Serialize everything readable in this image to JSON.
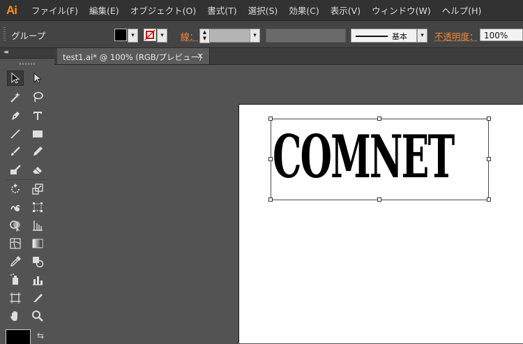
{
  "app": {
    "logo": "Ai"
  },
  "menu": [
    "ファイル(F)",
    "編集(E)",
    "オブジェクト(O)",
    "書式(T)",
    "選択(S)",
    "効果(C)",
    "表示(V)",
    "ウィンドウ(W)",
    "ヘルプ(H)"
  ],
  "control": {
    "selection_label": "グループ",
    "stroke_label": "線：",
    "stroke_profile": "基本",
    "opacity_label": "不透明度：",
    "opacity_value": "100%"
  },
  "document": {
    "tab_title": "test1.ai* @ 100% (RGB/プレビュー)",
    "close_symbol": "×"
  },
  "artwork": {
    "text": "COMNET"
  },
  "toolbar": {
    "collapse_symbol": "◂◂",
    "swap_symbol": "⇆",
    "tools": [
      "selection-tool",
      "direct-selection-tool",
      "magic-wand-tool",
      "lasso-tool",
      "pen-tool",
      "type-tool",
      "line-tool",
      "rectangle-tool",
      "paintbrush-tool",
      "pencil-tool",
      "blob-brush-tool",
      "eraser-tool",
      "rotate-tool",
      "scale-tool",
      "warp-tool",
      "free-transform-tool",
      "shape-builder-tool",
      "perspective-grid-tool",
      "mesh-tool",
      "gradient-tool",
      "eyedropper-tool",
      "blend-tool",
      "symbol-sprayer-tool",
      "column-graph-tool",
      "artboard-tool",
      "slice-tool",
      "hand-tool",
      "zoom-tool"
    ]
  },
  "colors": {
    "accent_orange": "#f0883a",
    "logo_orange": "#f7931e",
    "canvas_bg": "#535353"
  }
}
